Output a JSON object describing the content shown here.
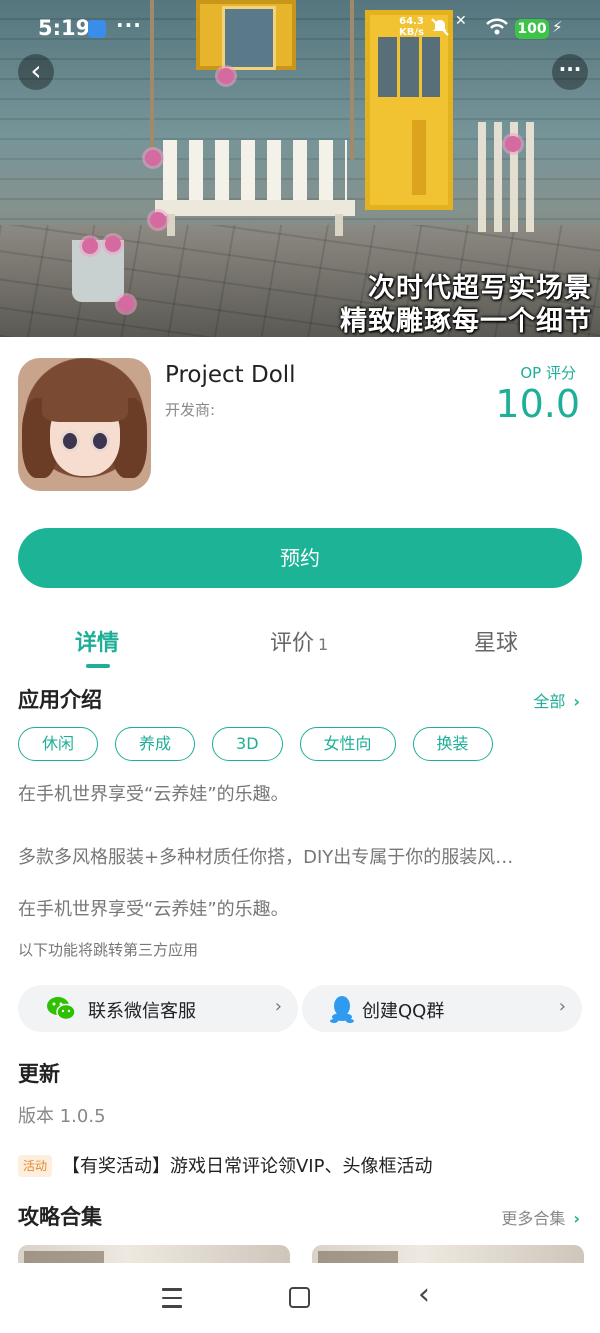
{
  "status_bar": {
    "time": "5:19",
    "dots": "···",
    "speed_value": "64.3",
    "speed_unit": "KB/s",
    "battery": "100"
  },
  "hero": {
    "caption_line1": "次时代超写实场景",
    "caption_line2": "精致雕琢每一个细节",
    "back_icon": "chevron-left-icon",
    "more_icon": "more-dots-icon",
    "more_label": "···"
  },
  "app": {
    "name": "Project Doll",
    "developer_label": "开发商:",
    "score_label": "OP 评分",
    "score": "10.0",
    "cta_label": "预约"
  },
  "tabs": [
    {
      "label": "详情",
      "count": ""
    },
    {
      "label": "评价",
      "count": "1"
    },
    {
      "label": "星球",
      "count": ""
    }
  ],
  "intro": {
    "title": "应用介绍",
    "more_label": "全部",
    "tags": [
      "休闲",
      "养成",
      "3D",
      "女性向",
      "换装"
    ],
    "desc_lines": [
      "在手机世界享受“云养娃”的乐趣。",
      "多款多风格服装+多种材质任你搭，DIY出专属于你的服装风…",
      "在手机世界享受“云养娃”的乐趣。"
    ],
    "third_party_notice": "以下功能将跳转第三方应用"
  },
  "contacts": [
    {
      "label": "联系微信客服",
      "icon": "wechat-icon"
    },
    {
      "label": "创建QQ群",
      "icon": "qq-icon"
    }
  ],
  "update": {
    "title": "更新",
    "version": "版本 1.0.5",
    "activity_badge": "活动",
    "activity_text": "【有奖活动】游戏日常评论领VIP、头像框活动"
  },
  "guides": {
    "title": "攻略合集",
    "more_label": "更多合集"
  },
  "colors": {
    "accent": "#1db397",
    "activity_badge_bg": "#fdeedd",
    "activity_badge_fg": "#e08a2e"
  }
}
